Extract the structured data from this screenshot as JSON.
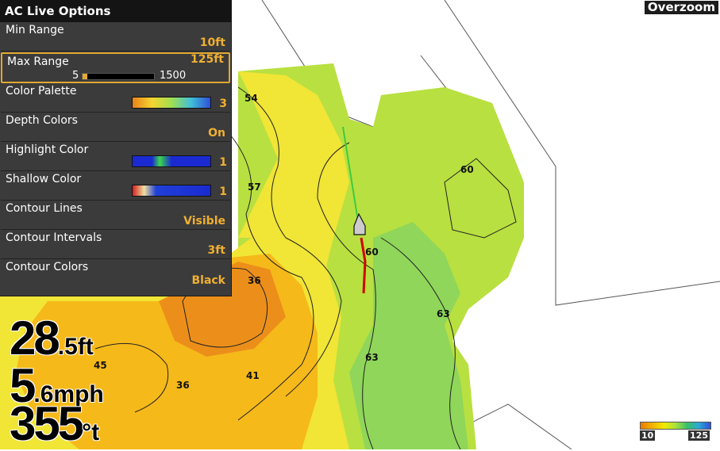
{
  "map": {
    "zoom_label": "Overzoom",
    "contour_labels": [
      "54",
      "57",
      "60",
      "36",
      "45",
      "41",
      "36",
      "63",
      "63",
      "60"
    ]
  },
  "panel": {
    "title": "AC Live Options",
    "options": [
      {
        "label": "Min Range",
        "value": "10ft"
      },
      {
        "label": "Max Range",
        "value": "125ft",
        "slider_min": "5",
        "slider_max": "1500",
        "selected": true
      },
      {
        "label": "Color Palette",
        "value": "3",
        "swatch": "palette-icon"
      },
      {
        "label": "Depth Colors",
        "value": "On"
      },
      {
        "label": "Highlight Color",
        "value": "1",
        "swatch": "highlight-swatch-icon"
      },
      {
        "label": "Shallow Color",
        "value": "1",
        "swatch": "shallow-swatch-icon"
      },
      {
        "label": "Contour Lines",
        "value": "Visible"
      },
      {
        "label": "Contour Intervals",
        "value": "3ft"
      },
      {
        "label": "Contour Colors",
        "value": "Black"
      }
    ]
  },
  "readouts": {
    "depth_int": "28",
    "depth_dec": ".5",
    "depth_unit": "ft",
    "speed_int": "5",
    "speed_dec": ".6",
    "speed_unit": "mph",
    "heading": "355",
    "heading_unit": "°t"
  },
  "legend": {
    "min": "10",
    "max": "125"
  },
  "colors": {
    "accent": "#e2a830",
    "panel": "#3b3b3b"
  }
}
